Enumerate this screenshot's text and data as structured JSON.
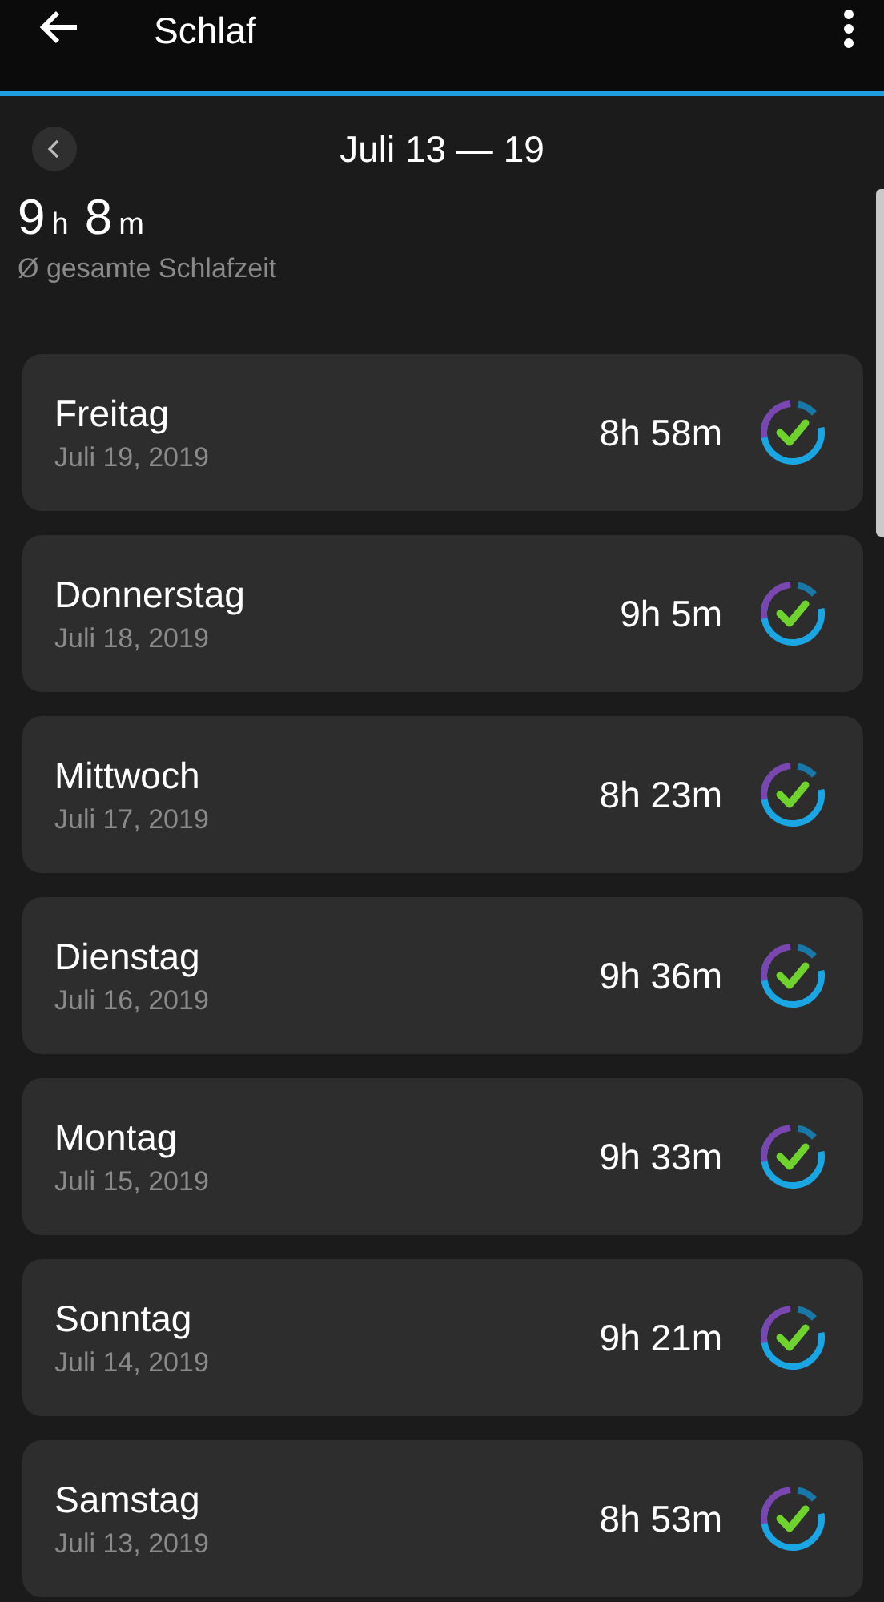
{
  "app_bar": {
    "title": "Schlaf"
  },
  "period": {
    "label": "Juli 13 — 19"
  },
  "summary": {
    "parts": [
      {
        "value": "9",
        "unit": "h"
      },
      {
        "value": "8",
        "unit": "m"
      }
    ],
    "caption": "Ø gesamte Schlafzeit"
  },
  "days": [
    {
      "day": "Freitag",
      "date": "Juli 19, 2019",
      "duration": "8h 58m"
    },
    {
      "day": "Donnerstag",
      "date": "Juli 18, 2019",
      "duration": "9h 5m"
    },
    {
      "day": "Mittwoch",
      "date": "Juli 17, 2019",
      "duration": "8h 23m"
    },
    {
      "day": "Dienstag",
      "date": "Juli 16, 2019",
      "duration": "9h 36m"
    },
    {
      "day": "Montag",
      "date": "Juli 15, 2019",
      "duration": "9h 33m"
    },
    {
      "day": "Sonntag",
      "date": "Juli 14, 2019",
      "duration": "9h 21m"
    },
    {
      "day": "Samstag",
      "date": "Juli 13, 2019",
      "duration": "8h 53m"
    }
  ]
}
